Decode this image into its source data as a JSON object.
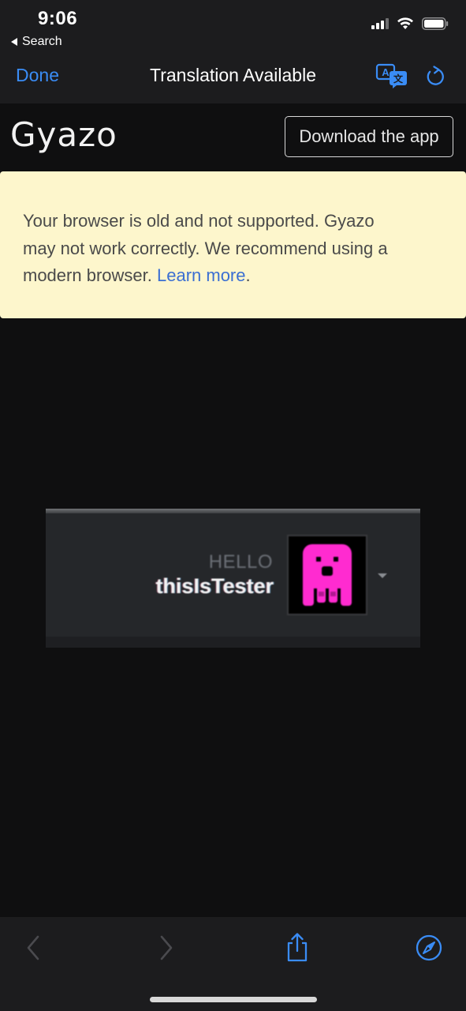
{
  "status_bar": {
    "time": "9:06",
    "back_app": "Search",
    "icons": [
      "cellular-signal-icon",
      "wifi-icon",
      "battery-icon"
    ]
  },
  "nav": {
    "done_label": "Done",
    "title": "Translation Available",
    "icons": [
      "translate-icon",
      "reload-icon"
    ]
  },
  "page": {
    "logo": "Gyazo",
    "download_label": "Download the app",
    "notice": {
      "text": "Your browser is old and not supported. Gyazo may not work correctly. We recommend using a modern browser.",
      "link": "Learn more",
      "suffix": "."
    }
  },
  "screenshot": {
    "greeting": "HELLO",
    "username": "thisIsTester",
    "avatar_color": "#ff2bd0",
    "icons": [
      "avatar-icon",
      "dropdown-caret-icon"
    ]
  },
  "toolbar": {
    "icons": [
      "back-arrow-icon",
      "forward-arrow-icon",
      "share-icon",
      "safari-compass-icon"
    ]
  },
  "colors": {
    "accent": "#3a8cf5",
    "notice_bg": "#fdf6cc",
    "link": "#3b6fd2",
    "bar_bg": "#1c1c1e",
    "page_bg": "#0f0f10"
  }
}
